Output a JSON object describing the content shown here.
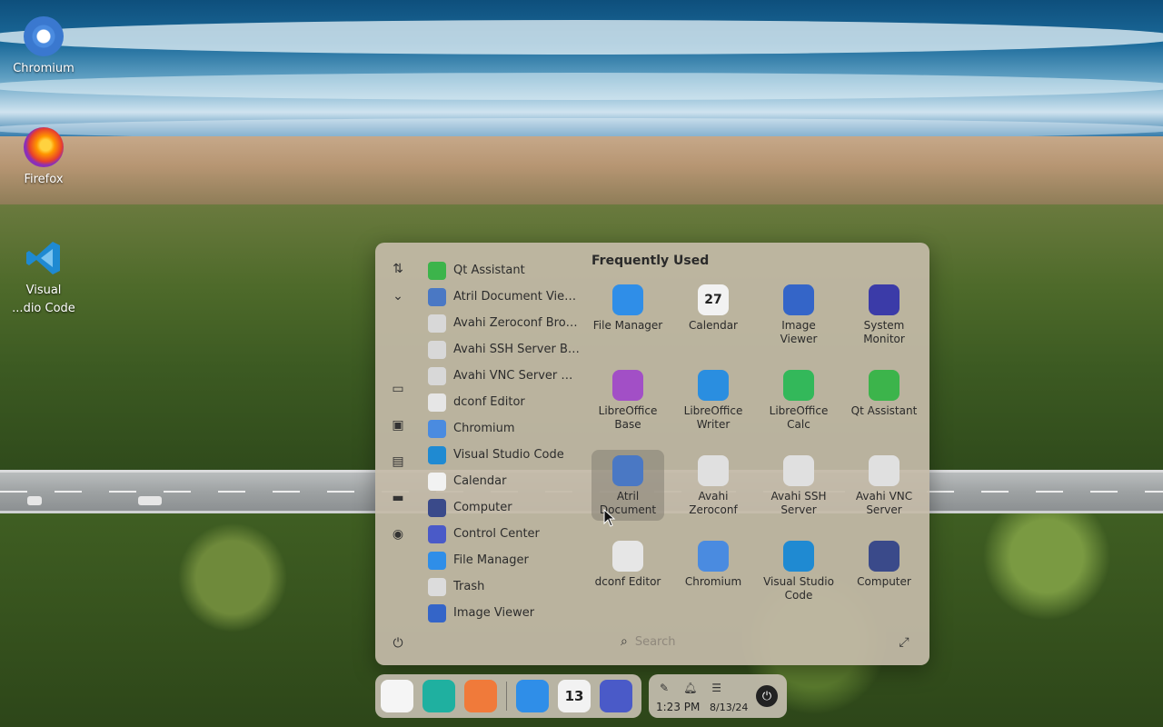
{
  "desktop": {
    "icons": [
      {
        "label": "Chromium",
        "icon": "chromium-icon"
      },
      {
        "label": "Firefox",
        "icon": "firefox-icon"
      },
      {
        "label": "Visual\n...dio Code",
        "icon": "vscode-icon"
      }
    ]
  },
  "launcher": {
    "sidebar_icons": [
      "sort-icon",
      "chevron-down-icon",
      "monitor-icon",
      "image-icon",
      "document-icon",
      "drive-icon",
      "music-icon",
      "power-icon"
    ],
    "app_list": [
      {
        "label": "Qt Assistant",
        "icon": "qt-assistant-icon",
        "color": "#3cb44b"
      },
      {
        "label": "Atril Document Viewer",
        "icon": "atril-icon",
        "color": "#4a78c4"
      },
      {
        "label": "Avahi Zeroconf Browser",
        "icon": "network-icon",
        "color": "#d8d8d8"
      },
      {
        "label": "Avahi SSH Server Brow…",
        "icon": "network-icon",
        "color": "#d8d8d8"
      },
      {
        "label": "Avahi VNC Server Bro…",
        "icon": "network-icon",
        "color": "#d8d8d8"
      },
      {
        "label": "dconf Editor",
        "icon": "dconf-icon",
        "color": "#e6e6e6"
      },
      {
        "label": "Chromium",
        "icon": "chromium-icon",
        "color": "#4a8be0"
      },
      {
        "label": "Visual Studio Code",
        "icon": "vscode-icon",
        "color": "#1f8ad2"
      },
      {
        "label": "Calendar",
        "icon": "calendar-icon",
        "color": "#f2f2f2"
      },
      {
        "label": "Computer",
        "icon": "computer-icon",
        "color": "#3a4a8a"
      },
      {
        "label": "Control Center",
        "icon": "control-center-icon",
        "color": "#4a5ac8"
      },
      {
        "label": "File Manager",
        "icon": "file-manager-icon",
        "color": "#2f8ee8"
      },
      {
        "label": "Trash",
        "icon": "trash-icon",
        "color": "#dcdcdc"
      },
      {
        "label": "Image Viewer",
        "icon": "image-viewer-icon",
        "color": "#3465c8"
      }
    ],
    "frequently_used_title": "Frequently Used",
    "frequently_used": [
      {
        "label": "File Manager",
        "icon": "file-manager-icon",
        "color": "#2f8ee8"
      },
      {
        "label": "Calendar",
        "icon": "calendar-icon",
        "color": "#f2f2f2",
        "badge": "27"
      },
      {
        "label": "Image Viewer",
        "icon": "image-viewer-icon",
        "color": "#3465c8"
      },
      {
        "label": "System\nMonitor",
        "icon": "system-monitor-icon",
        "color": "#3b3ba8"
      },
      {
        "label": "LibreOffice\nBase",
        "icon": "libreoffice-base-icon",
        "color": "#a24fc6"
      },
      {
        "label": "LibreOffice\nWriter",
        "icon": "libreoffice-writer-icon",
        "color": "#2a8ee0"
      },
      {
        "label": "LibreOffice\nCalc",
        "icon": "libreoffice-calc-icon",
        "color": "#33b85a"
      },
      {
        "label": "Qt Assistant",
        "icon": "qt-assistant-icon",
        "color": "#3cb44b"
      },
      {
        "label": "Atril\nDocument",
        "icon": "atril-icon",
        "color": "#4a78c4"
      },
      {
        "label": "Avahi\nZeroconf",
        "icon": "network-icon",
        "color": "#e0e0e0"
      },
      {
        "label": "Avahi SSH\nServer",
        "icon": "network-icon",
        "color": "#e0e0e0"
      },
      {
        "label": "Avahi VNC\nServer",
        "icon": "network-icon",
        "color": "#e0e0e0"
      },
      {
        "label": "dconf Editor",
        "icon": "dconf-icon",
        "color": "#e6e6e6"
      },
      {
        "label": "Chromium",
        "icon": "chromium-icon",
        "color": "#4a8be0"
      },
      {
        "label": "Visual Studio\nCode",
        "icon": "vscode-icon",
        "color": "#1f8ad2"
      },
      {
        "label": "Computer",
        "icon": "computer-icon",
        "color": "#3a4a8a"
      }
    ],
    "selected_tile": "Atril\nDocument",
    "search_placeholder": "Search"
  },
  "dock": {
    "items": [
      {
        "icon": "launcher-icon",
        "color": "#f5f5f5"
      },
      {
        "icon": "multitasking-icon",
        "color": "#1fb0a0"
      },
      {
        "icon": "workspace-icon",
        "color": "#f07a3a"
      },
      {
        "icon": "file-manager-icon",
        "color": "#2f8ee8"
      },
      {
        "icon": "calendar-icon",
        "color": "#f2f2f2",
        "badge": "13"
      },
      {
        "icon": "control-center-icon",
        "color": "#4a5ac8"
      }
    ]
  },
  "tray": {
    "icons": [
      "pen-icon",
      "bell-icon",
      "toggles-icon"
    ],
    "time": "1:23 PM",
    "date": "8/13/24"
  }
}
